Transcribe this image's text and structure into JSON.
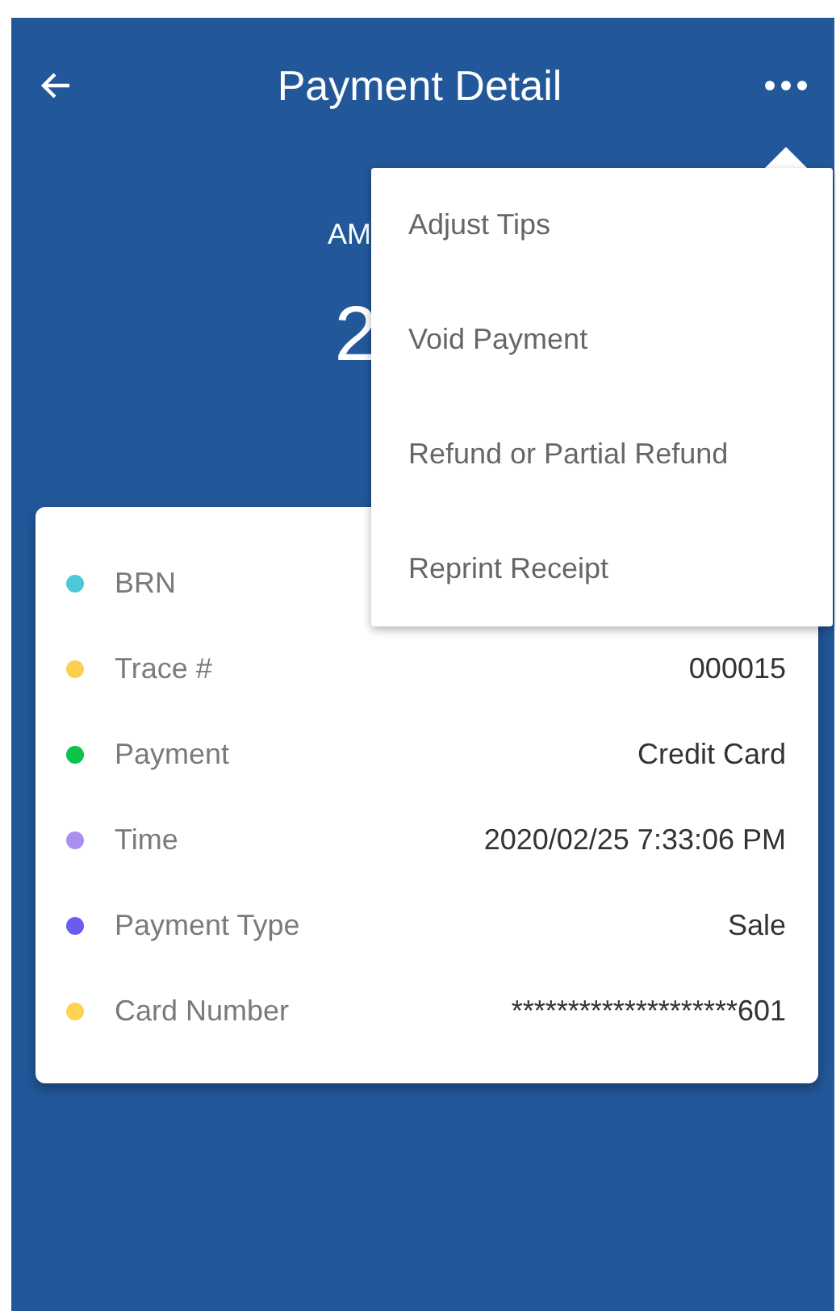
{
  "header": {
    "title": "Payment Detail"
  },
  "amount": {
    "label": "AM",
    "value": "2"
  },
  "details": [
    {
      "label": "BRN",
      "color": "#4dc9d6"
    },
    {
      "label": "Trace #",
      "value": "000015",
      "color": "#fcd04e"
    },
    {
      "label": "Payment",
      "value": "Credit Card",
      "color": "#0dc24a"
    },
    {
      "label": "Time",
      "value": "2020/02/25 7:33:06 PM",
      "color": "#a98ff0"
    },
    {
      "label": "Payment Type",
      "value": "Sale",
      "color": "#6a5cf0"
    },
    {
      "label": "Card Number",
      "value": "********************601",
      "color": "#fdd34f"
    }
  ],
  "menu": {
    "items": [
      "Adjust Tips",
      "Void Payment",
      "Refund or Partial Refund",
      "Reprint Receipt"
    ]
  }
}
